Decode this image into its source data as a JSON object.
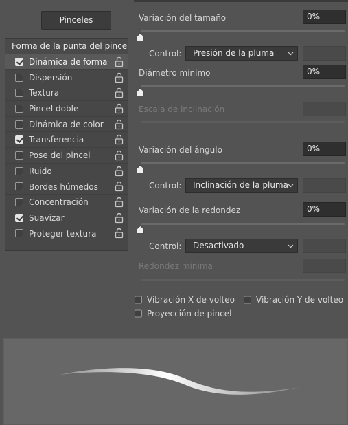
{
  "tab_button": "Pinceles",
  "left_panel": {
    "header": "Forma de la punta del pincel",
    "items": [
      {
        "label": "Dinámica de forma",
        "checked": true,
        "selected": true
      },
      {
        "label": "Dispersión",
        "checked": false,
        "selected": false
      },
      {
        "label": "Textura",
        "checked": false,
        "selected": false
      },
      {
        "label": "Pincel doble",
        "checked": false,
        "selected": false
      },
      {
        "label": "Dinámica de color",
        "checked": false,
        "selected": false
      },
      {
        "label": "Transferencia",
        "checked": true,
        "selected": false
      },
      {
        "label": "Pose del pincel",
        "checked": false,
        "selected": false
      },
      {
        "label": "Ruido",
        "checked": false,
        "selected": false
      },
      {
        "label": "Bordes húmedos",
        "checked": false,
        "selected": false
      },
      {
        "label": "Concentración",
        "checked": false,
        "selected": false
      },
      {
        "label": "Suavizar",
        "checked": true,
        "selected": false
      },
      {
        "label": "Proteger textura",
        "checked": false,
        "selected": false
      }
    ]
  },
  "settings": {
    "size_jitter": {
      "label": "Variación del tamaño",
      "value": "0%",
      "slider_fraction": 0
    },
    "size_control": {
      "label": "Control:",
      "value": "Presión de la pluma"
    },
    "min_diameter": {
      "label": "Diámetro mínimo",
      "value": "0%",
      "slider_fraction": 0
    },
    "tilt_scale": {
      "label": "Escala de inclinación",
      "value": ""
    },
    "angle_jitter": {
      "label": "Variación del ángulo",
      "value": "0%",
      "slider_fraction": 0
    },
    "angle_control": {
      "label": "Control:",
      "value": "Inclinación de la pluma"
    },
    "roundness_jitter": {
      "label": "Variación de la redondez",
      "value": "0%",
      "slider_fraction": 0
    },
    "roundness_control": {
      "label": "Control:",
      "value": "Desactivado"
    },
    "min_roundness": {
      "label": "Redondez mínima",
      "value": ""
    }
  },
  "options": {
    "flip_x": {
      "label": "Vibración X de volteo",
      "checked": false
    },
    "flip_y": {
      "label": "Vibración Y de volteo",
      "checked": false
    },
    "brush_projection": {
      "label": "Proyección de pincel",
      "checked": false
    }
  },
  "colors": {
    "panel_bg": "#535353",
    "field_bg": "#2f2f2f",
    "text": "#dcdcdc",
    "disabled_text": "#7a7a7a"
  },
  "icons": {
    "lock": "unlock-icon",
    "dropdown": "chevron-down-icon",
    "slider": "slider-thumb-icon"
  }
}
